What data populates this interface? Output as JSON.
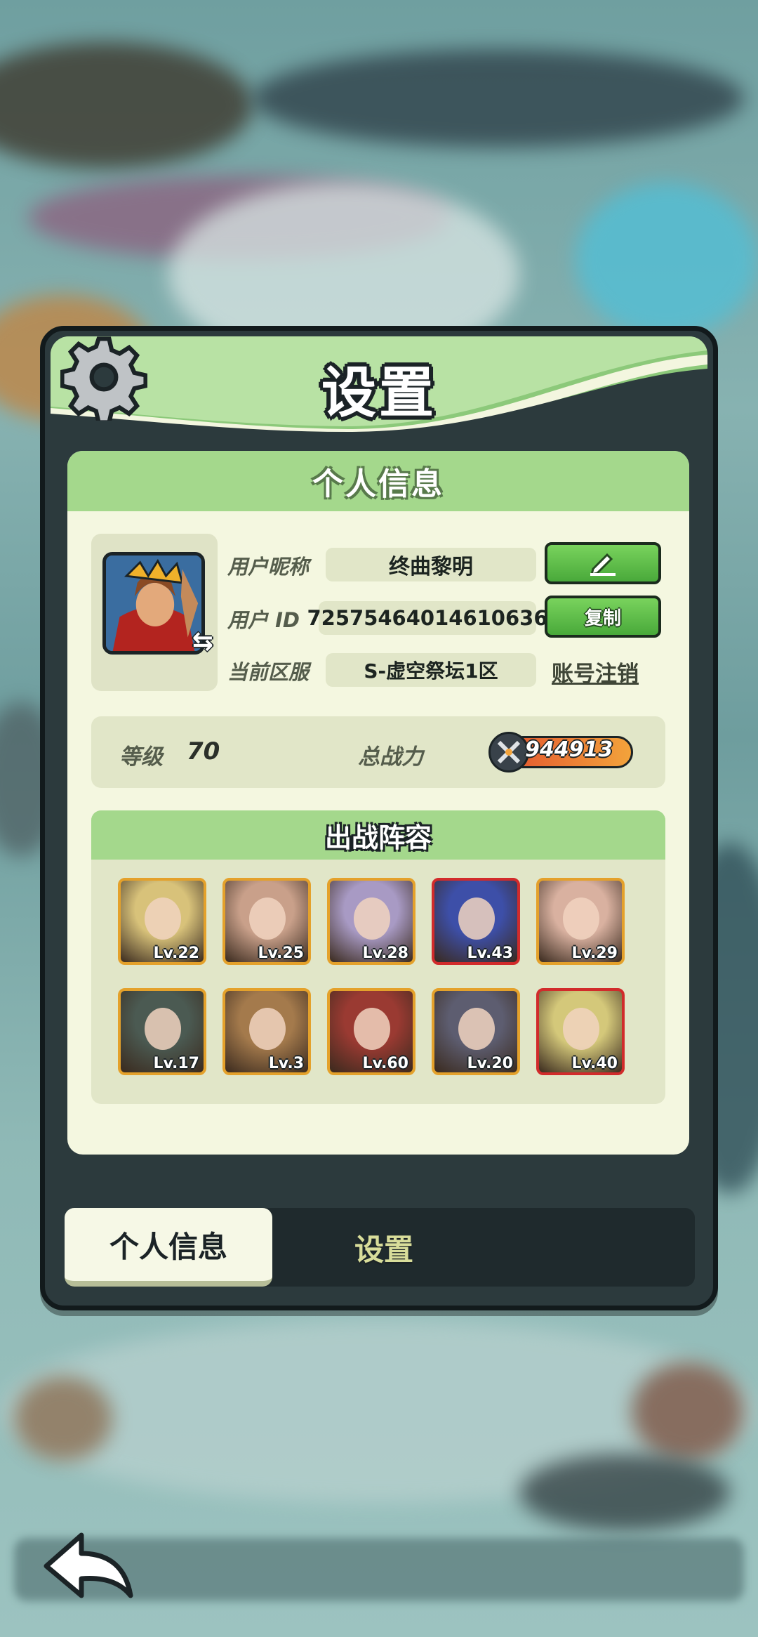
{
  "dialog": {
    "title": "设置",
    "panel_title": "个人信息"
  },
  "profile": {
    "nickname_label": "用户昵称",
    "nickname": "终曲黎明",
    "id_label": "用户   ID",
    "user_id": "72575464014610636",
    "server_label": "当前区服",
    "server": "S-虚空祭坛1区",
    "copy_button": "复制",
    "deregister_link": "账号注销"
  },
  "stats": {
    "level_label": "等级",
    "level": "70",
    "power_label": "总战力",
    "power": "944913"
  },
  "team": {
    "title": "出战阵容",
    "heroes": [
      {
        "level": "Lv.22",
        "frame": "gold",
        "color": "#d8c27a"
      },
      {
        "level": "Lv.25",
        "frame": "gold",
        "color": "#c9a08a"
      },
      {
        "level": "Lv.28",
        "frame": "gold",
        "color": "#a89ac4"
      },
      {
        "level": "Lv.43",
        "frame": "red",
        "color": "#3d4fa8"
      },
      {
        "level": "Lv.29",
        "frame": "gold",
        "color": "#d9b1a0"
      },
      {
        "level": "Lv.17",
        "frame": "gold",
        "color": "#4b5a52"
      },
      {
        "level": "Lv.3",
        "frame": "gold",
        "color": "#a47a4c"
      },
      {
        "level": "Lv.60",
        "frame": "gold",
        "color": "#9a3a32"
      },
      {
        "level": "Lv.20",
        "frame": "gold",
        "color": "#5d5d70"
      },
      {
        "level": "Lv.40",
        "frame": "red",
        "color": "#d4c87a"
      }
    ]
  },
  "tabs": {
    "personal_info": "个人信息",
    "settings": "设置"
  },
  "colors": {
    "header_green": "#8cc97a",
    "panel_bg": "#f4f7e0",
    "button_green": "#49a93a",
    "frame_gold": "#e4a12b",
    "frame_red": "#d12b2b"
  },
  "icons": [
    "gear-icon",
    "edit-icon",
    "swap-icon",
    "power-swords-icon",
    "back-arrow-icon"
  ]
}
